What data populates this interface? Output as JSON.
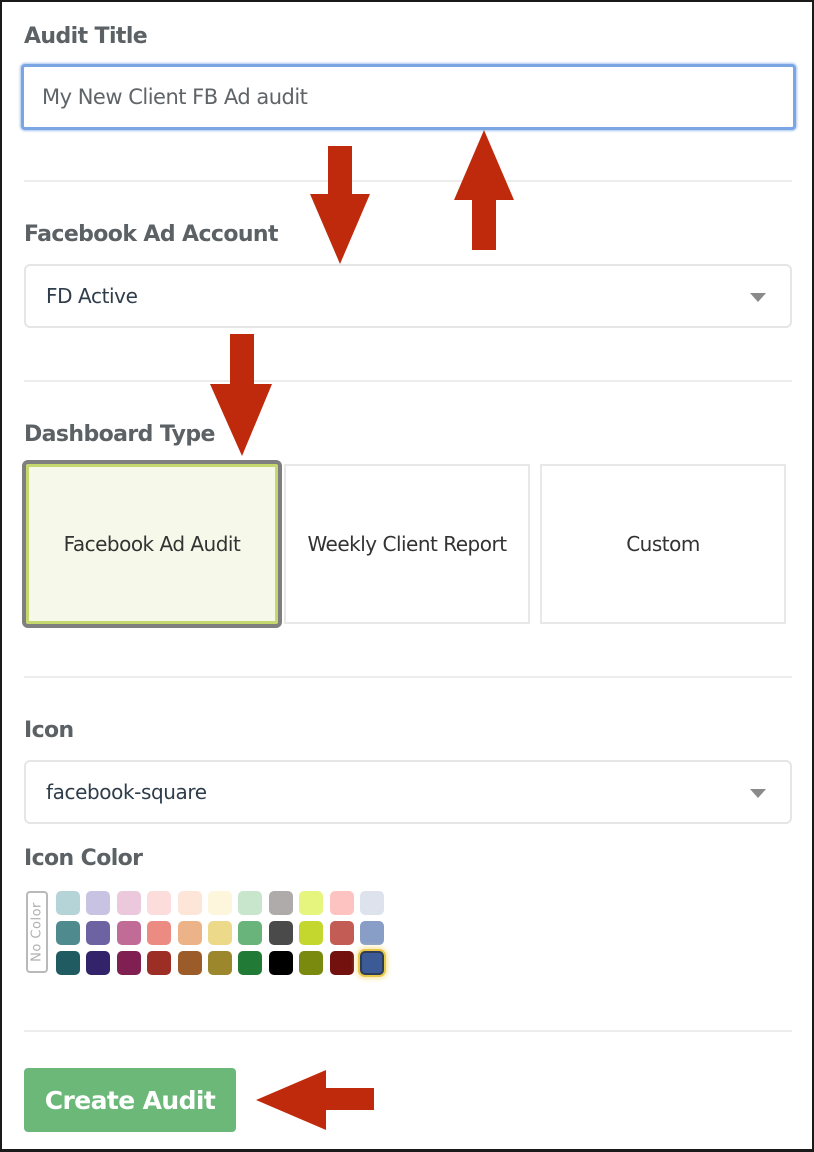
{
  "form": {
    "audit_title": {
      "label": "Audit Title",
      "value": "My New Client FB Ad audit"
    },
    "ad_account": {
      "label": "Facebook Ad Account",
      "selected": "FD Active"
    },
    "dashboard_type": {
      "label": "Dashboard Type",
      "options": [
        {
          "label": "Facebook Ad Audit",
          "selected": true
        },
        {
          "label": "Weekly Client Report",
          "selected": false
        },
        {
          "label": "Custom",
          "selected": false
        }
      ]
    },
    "icon": {
      "label": "Icon",
      "selected": "facebook-square"
    },
    "icon_color": {
      "label": "Icon Color",
      "no_color_label": "No Color",
      "rows": [
        [
          "#b5d4d8",
          "#c8c3e3",
          "#ebc8dc",
          "#fddcdc",
          "#fde6d8",
          "#fdf5dc",
          "#c8e6cc",
          "#b0abab",
          "#e6f57e",
          "#fdc3c0",
          "#dde2ec"
        ],
        [
          "#4f8a8f",
          "#6d63a3",
          "#c16c96",
          "#ec8b82",
          "#ecb388",
          "#ecda8a",
          "#68b47a",
          "#4a4a4a",
          "#c4d72f",
          "#c45c56",
          "#899ec7"
        ],
        [
          "#1f5b60",
          "#32236b",
          "#801f52",
          "#9c2e26",
          "#9c5c29",
          "#9c872c",
          "#217a35",
          "#000000",
          "#7a8a0f",
          "#72110e",
          "#3c5a96"
        ]
      ],
      "selected": "#3c5a96"
    },
    "submit_label": "Create Audit"
  },
  "annotations": {
    "arrow_color": "#c02a0c"
  }
}
